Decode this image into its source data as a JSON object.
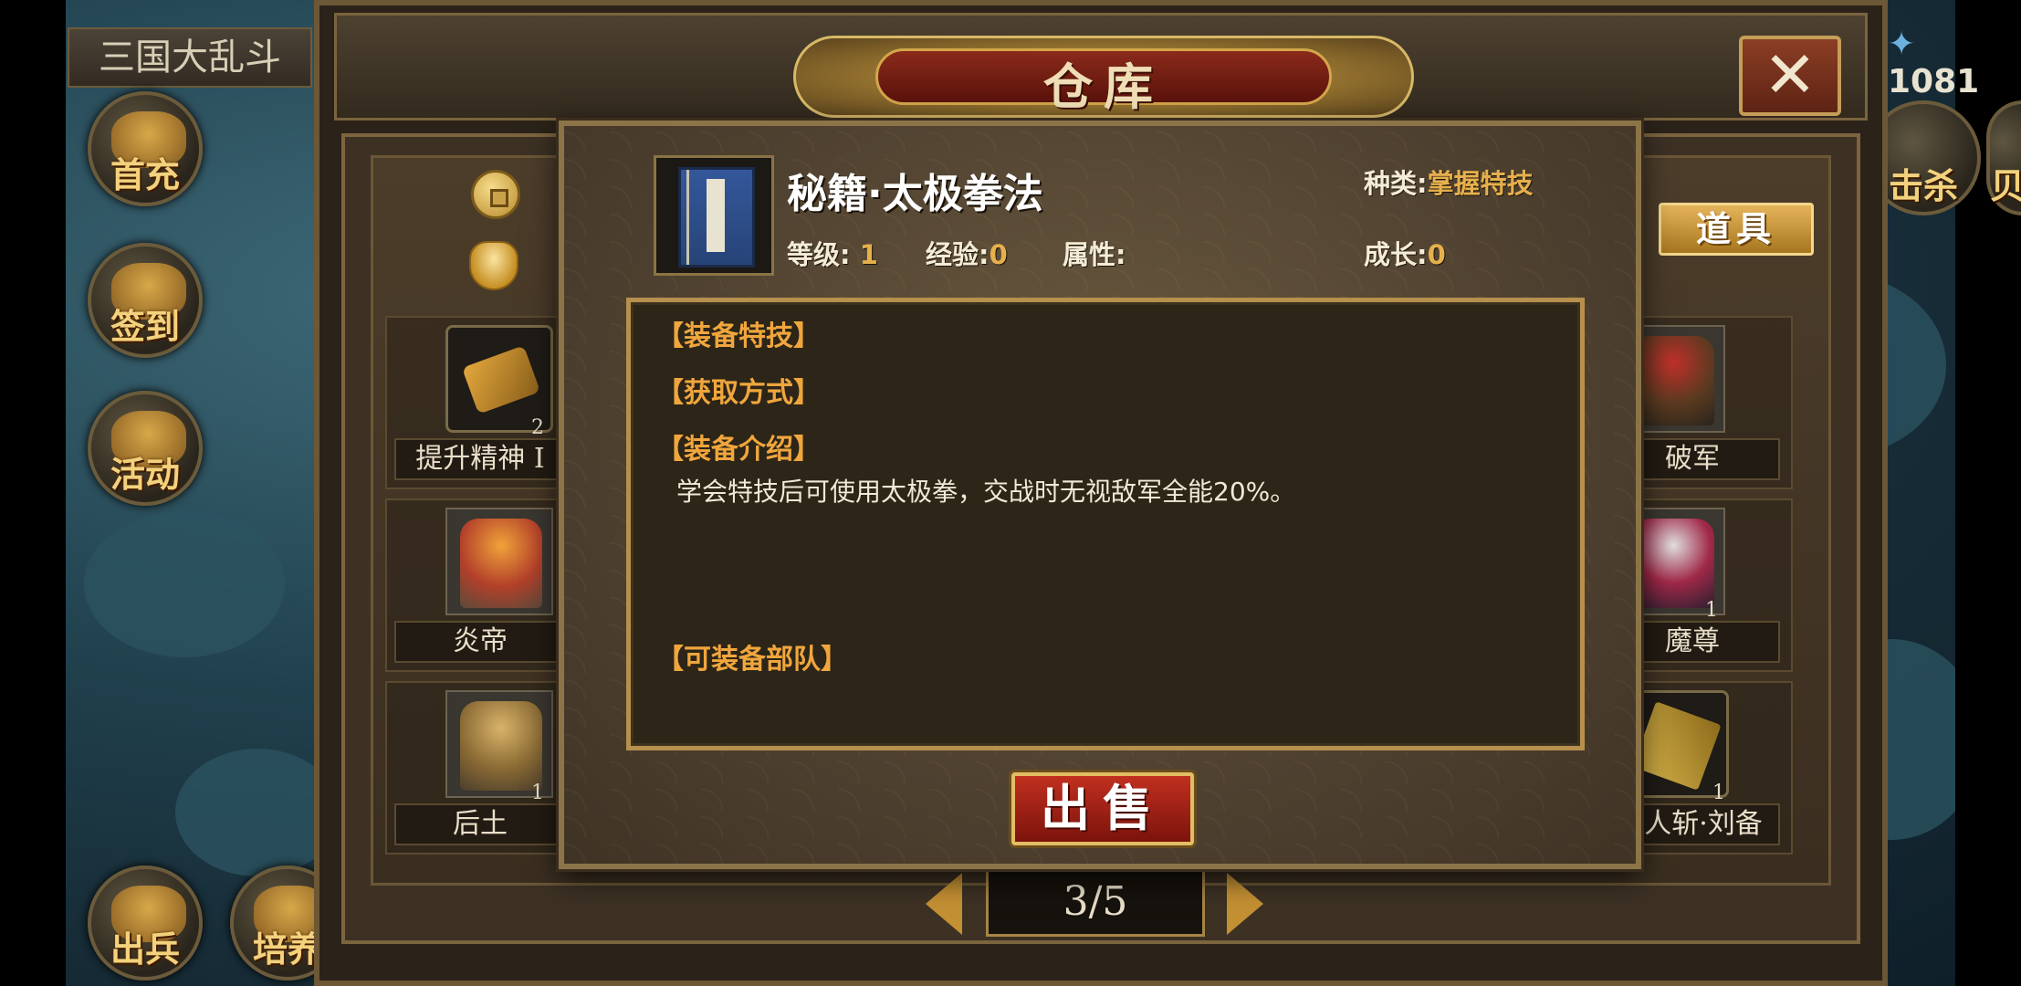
{
  "background": {
    "side_title": "三国大乱斗",
    "left_buttons": [
      {
        "label": "首充"
      },
      {
        "label": "签到"
      },
      {
        "label": "活动"
      },
      {
        "label": "出兵"
      },
      {
        "label": "培养"
      }
    ],
    "top_right_value": "1081",
    "right_buttons": [
      {
        "label": "击杀"
      },
      {
        "label": "贝"
      }
    ]
  },
  "warehouse": {
    "title": "仓库",
    "tab_label": "道具",
    "slots_left": [
      {
        "name": "提升精神 I",
        "count": "2",
        "kind": "item"
      },
      {
        "name": "炎帝",
        "count": "",
        "kind": "hero"
      },
      {
        "name": "后土",
        "count": "1",
        "kind": "hero"
      }
    ],
    "slots_right": [
      {
        "name": "破军",
        "count": "",
        "kind": "hero"
      },
      {
        "name": "魔尊",
        "count": "1",
        "kind": "hero"
      },
      {
        "name": "万人斩·刘备",
        "count": "1",
        "kind": "item"
      }
    ],
    "pager": {
      "text": "3/5",
      "current": 3,
      "total": 5
    }
  },
  "detail": {
    "name": "秘籍·太极拳法",
    "category_label": "种类:",
    "category_value": "掌握特技",
    "level_label": "等级:",
    "level_value": "1",
    "exp_label": "经验:",
    "exp_value": "0",
    "attr_label": "属性:",
    "attr_value": "",
    "growth_label": "成长:",
    "growth_value": "0",
    "sections": {
      "equip_skill": "【装备特技】",
      "obtain": "【获取方式】",
      "intro": "【装备介绍】",
      "intro_text": "学会特技后可使用太极拳，交战时无视敌军全能20%。",
      "equip_troops": "【可装备部队】"
    },
    "sell_label": "出售"
  },
  "colors": {
    "gold_text": "#e6b04c",
    "section_orange": "#f0a63d",
    "frame_gold": "#b6904c",
    "sell_red": "#a8231a"
  }
}
